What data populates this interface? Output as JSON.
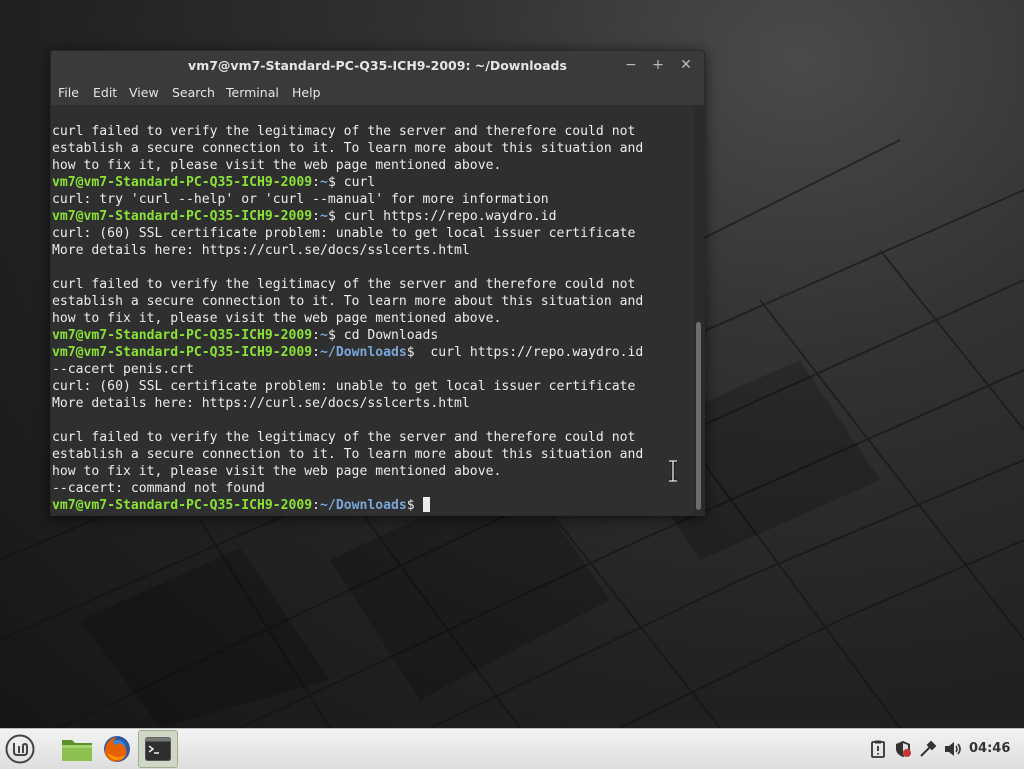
{
  "window": {
    "title": "vm7@vm7-Standard-PC-Q35-ICH9-2009: ~/Downloads",
    "minimize": "−",
    "maximize": "+",
    "close": "✕"
  },
  "menu": {
    "file": "File",
    "edit": "Edit",
    "view": "View",
    "search": "Search",
    "terminal": "Terminal",
    "help": "Help"
  },
  "terminal": {
    "user_host": "vm7@vm7-Standard-PC-Q35-ICH9-2009",
    "prompt_sep": ":",
    "home_dir": "~",
    "downloads_dir": "~/Downloads",
    "prompt_end": "$",
    "lines": {
      "l0": "curl failed to verify the legitimacy of the server and therefore could not",
      "l1": "establish a secure connection to it. To learn more about this situation and",
      "l2": "how to fix it, please visit the web page mentioned above.",
      "l3_cmd": " curl",
      "l4": "curl: try 'curl --help' or 'curl --manual' for more information",
      "l5_cmd": " curl https://repo.waydro.id",
      "l6": "curl: (60) SSL certificate problem: unable to get local issuer certificate",
      "l7": "More details here: https://curl.se/docs/sslcerts.html",
      "l9": "curl failed to verify the legitimacy of the server and therefore could not",
      "l10": "establish a secure connection to it. To learn more about this situation and",
      "l11": "how to fix it, please visit the web page mentioned above.",
      "l12_cmd": " cd Downloads",
      "l13_cmd": "  curl https://repo.waydro.id",
      "l14": "--cacert penis.crt",
      "l15": "curl: (60) SSL certificate problem: unable to get local issuer certificate",
      "l16": "More details here: https://curl.se/docs/sslcerts.html",
      "l18": "curl failed to verify the legitimacy of the server and therefore could not",
      "l19": "establish a secure connection to it. To learn more about this situation and",
      "l20": "how to fix it, please visit the web page mentioned above.",
      "l21": "--cacert: command not found",
      "l22_cmd": " "
    }
  },
  "taskbar": {
    "clock": "04:46",
    "icons": [
      "linux-mint-menu-icon",
      "folder-icon",
      "firefox-icon",
      "terminal-icon"
    ],
    "tray_icons": [
      "clipboard-icon",
      "shield-icon",
      "network-icon",
      "volume-icon"
    ]
  },
  "colors": {
    "prompt_user": "#8ae234",
    "prompt_path": "#7aa6da",
    "terminal_bg": "#2f2f2f",
    "titlebar": "#3a3a3a",
    "mint_green": "#6daa3a"
  }
}
